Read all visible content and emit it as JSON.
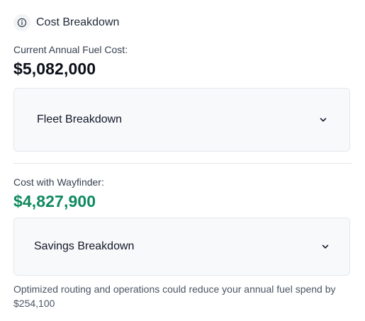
{
  "header": {
    "icon": "info-icon",
    "title": "Cost Breakdown"
  },
  "current": {
    "label": "Current Annual Fuel Cost:",
    "amount": "$5,082,000",
    "accordion": {
      "title": "Fleet Breakdown",
      "expanded": false,
      "icon": "chevron-down-icon"
    }
  },
  "wayfinder": {
    "label": "Cost with Wayfinder:",
    "amount": "$4,827,900",
    "amount_color": "#0f8a5f",
    "accordion": {
      "title": "Savings Breakdown",
      "expanded": false,
      "icon": "chevron-down-icon"
    }
  },
  "note": {
    "text": "Optimized routing and operations could reduce your annual fuel spend by $254,100"
  }
}
